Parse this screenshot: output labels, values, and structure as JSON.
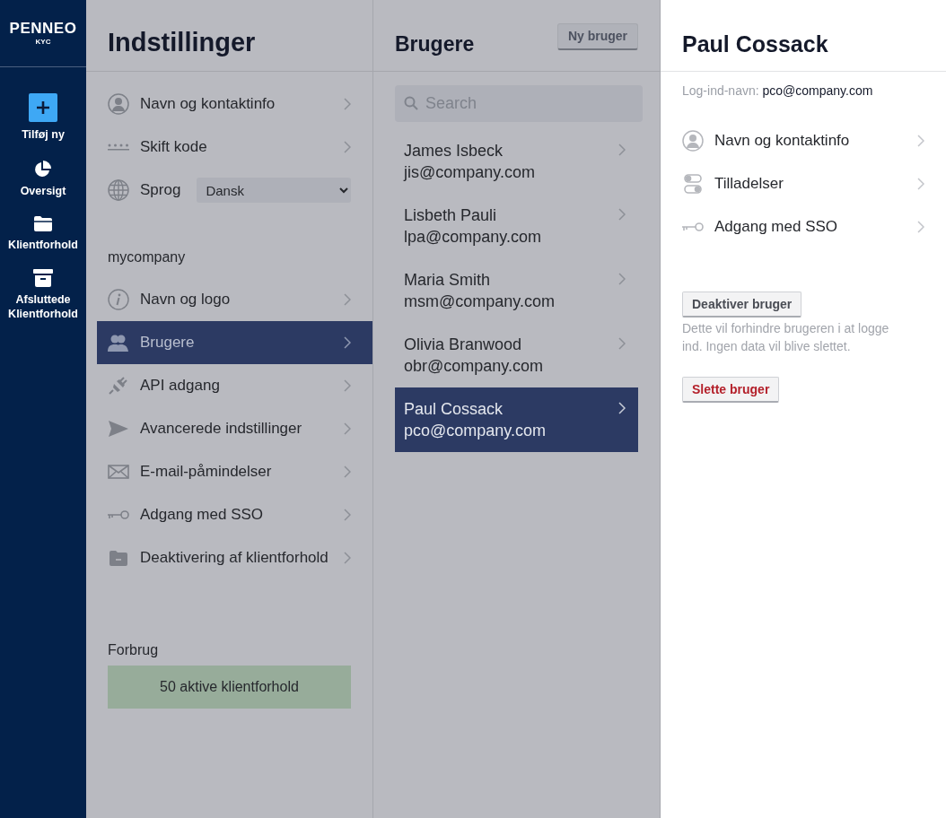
{
  "nav": {
    "logo": "PENNEO",
    "logo_sub": "KYC",
    "items": [
      {
        "label": "Tilføj ny"
      },
      {
        "label": "Oversigt"
      },
      {
        "label": "Klientforhold"
      },
      {
        "label": "Afsluttede Klientforhold"
      }
    ]
  },
  "settings": {
    "title": "Indstillinger",
    "personal_items": [
      {
        "kind": "link",
        "label": "Navn og kontaktinfo"
      },
      {
        "kind": "link",
        "label": "Skift kode"
      },
      {
        "kind": "select",
        "label": "Sprog",
        "value": "Dansk"
      }
    ],
    "company": {
      "name": "mycompany",
      "items": [
        {
          "label": "Navn og logo",
          "selected": false
        },
        {
          "label": "Brugere",
          "selected": true
        },
        {
          "label": "API adgang",
          "selected": false
        },
        {
          "label": "Avancerede indstillinger",
          "selected": false
        },
        {
          "label": "E-mail-påmindelser",
          "selected": false
        },
        {
          "label": "Adgang med SSO",
          "selected": false
        },
        {
          "label": "Deaktivering af klientforhold",
          "selected": false
        }
      ]
    },
    "usage": {
      "title": "Forbrug",
      "value": "50 aktive klientforhold"
    }
  },
  "users": {
    "title": "Brugere",
    "new_button": "Ny bruger",
    "search": {
      "placeholder": "Search"
    },
    "rows": [
      {
        "name": "James Isbeck",
        "email": "jis@company.com",
        "selected": false
      },
      {
        "name": "Lisbeth Pauli",
        "email": "lpa@company.com",
        "selected": false
      },
      {
        "name": "Maria Smith",
        "email": "msm@company.com",
        "selected": false
      },
      {
        "name": "Olivia Branwood",
        "email": "obr@company.com",
        "selected": false
      },
      {
        "name": "Paul Cossack",
        "email": "pco@company.com",
        "selected": true
      }
    ]
  },
  "detail": {
    "title": "Paul Cossack",
    "login_label": "Log-ind-navn:",
    "login_value": "pco@company.com",
    "items": [
      {
        "label": "Navn og kontaktinfo"
      },
      {
        "label": "Tilladelser"
      },
      {
        "label": "Adgang med SSO"
      }
    ],
    "deactivate_button": "Deaktiver bruger",
    "deactivate_note": "Dette vil forhindre brugeren i at logge ind. Ingen data vil blive slettet.",
    "delete_button": "Slette bruger"
  }
}
